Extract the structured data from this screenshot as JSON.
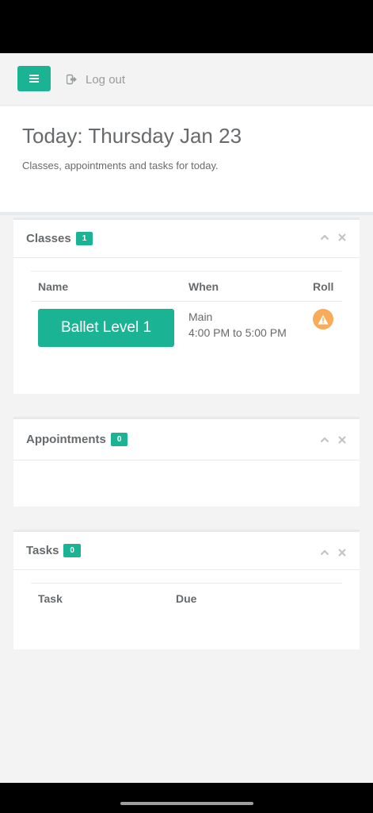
{
  "topbar": {
    "logout_label": "Log out"
  },
  "heading": {
    "title": "Today: Thursday Jan 23",
    "subtitle": "Classes, appointments and tasks for today."
  },
  "classes": {
    "title": "Classes",
    "count": "1",
    "columns": [
      "Name",
      "When",
      "Roll"
    ],
    "rows": [
      {
        "name": "Ballet Level 1",
        "location": "Main",
        "time": "4:00 PM to 5:00 PM",
        "roll_status": "warning"
      }
    ]
  },
  "appointments": {
    "title": "Appointments",
    "count": "0"
  },
  "tasks": {
    "title": "Tasks",
    "count": "0",
    "columns": [
      "Task",
      "Due"
    ]
  },
  "colors": {
    "accent": "#1ab394",
    "warning": "#f8ac59"
  }
}
